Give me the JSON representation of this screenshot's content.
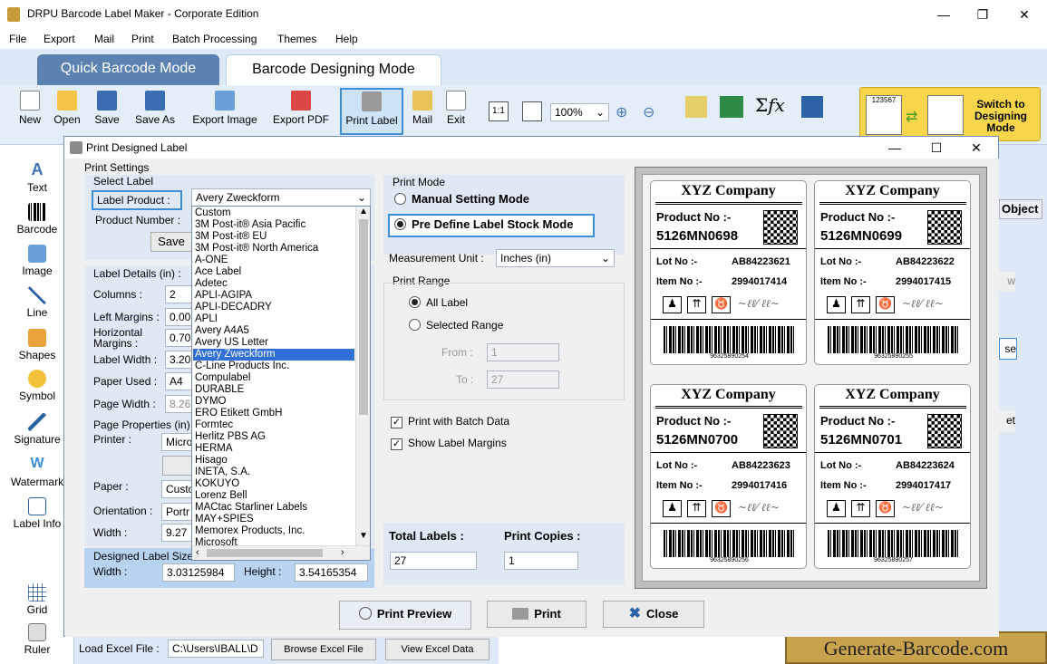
{
  "app": {
    "title": "DRPU Barcode Label Maker - Corporate Edition"
  },
  "menu": [
    "File",
    "Export",
    "Mail",
    "Print",
    "Batch Processing",
    "Themes",
    "Help"
  ],
  "modes": {
    "quick": "Quick Barcode Mode",
    "designing": "Barcode Designing Mode"
  },
  "ribbon": {
    "buttons": [
      "New",
      "Open",
      "Save",
      "Save As",
      "Export Image",
      "Export PDF",
      "Print Label",
      "Mail",
      "Exit"
    ],
    "zoom": "100%",
    "switch_label": "Switch to Designing Mode",
    "thumb_text": "123567"
  },
  "tools": [
    "Text",
    "Barcode",
    "Image",
    "Line",
    "Shapes",
    "Symbol",
    "Signature",
    "Watermark",
    "Label Info",
    "Grid",
    "Ruler"
  ],
  "background": {
    "object_tab": "Object",
    "btn_w": "w",
    "btn_se": "se",
    "btn_et": "et"
  },
  "dialog": {
    "title": "Print Designed Label",
    "print_settings": "Print Settings",
    "select_label": "Select Label",
    "label_product_label": "Label Product :",
    "label_product_value": "Avery Zweckform",
    "product_number_label": "Product Number :",
    "save_btn": "Save",
    "label_details_title": "Label Details (in) :",
    "columns_label": "Columns :",
    "columns_value": "2",
    "left_margins_label": "Left Margins :",
    "left_margins_value": "0.00",
    "horizontal_margins_label": "Horizontal Margins :",
    "horizontal_margins_value": "0.70",
    "label_width_label": "Label Width :",
    "label_width_value": "3.20",
    "paper_used_label": "Paper Used :",
    "paper_used_value": "A4",
    "page_width_label": "Page Width :",
    "page_width_value": "8.26",
    "page_properties_title": "Page Properties (in) :",
    "printer_label": "Printer :",
    "printer_value": "Micro",
    "paper_label": "Paper :",
    "paper_value": "Custo",
    "orientation_label": "Orientation :",
    "orientation_value": "Portr",
    "width_label": "Width :",
    "width_value": "9.27",
    "designed_size_title": "Designed Label Size",
    "designed_width_label": "Width :",
    "designed_width_value": "3.03125984",
    "designed_height_label": "Height :",
    "designed_height_value": "3.54165354",
    "dropdown_items": [
      "Custom",
      "3M  Post-it®  Asia Pacific",
      "3M  Post-it®  EU",
      "3M  Post-it®  North America",
      "A-ONE",
      "Ace Label",
      "Adetec",
      "APLI-AGIPA",
      "APLI-DECADRY",
      "APLI",
      "Avery A4A5",
      "Avery US Letter",
      "Avery Zweckform",
      "C-Line Products Inc.",
      "Compulabel",
      "DURABLE",
      "DYMO",
      "ERO Etikett GmbH",
      "Formtec",
      "Herlitz PBS AG",
      "HERMA",
      "Hisago",
      "INETA, S.A.",
      "KOKUYO",
      "Lorenz Bell",
      "MACtac Starliner Labels",
      "MAY+SPIES",
      "Memorex Products, Inc.",
      "Microsoft"
    ],
    "dropdown_selected": "Avery Zweckform",
    "print_mode_title": "Print Mode",
    "manual_mode": "Manual Setting Mode",
    "predefine_mode": "Pre Define Label Stock Mode",
    "measurement_label": "Measurement Unit :",
    "measurement_value": "Inches (in)",
    "print_range_title": "Print Range",
    "all_label": "All Label",
    "selected_range": "Selected Range",
    "from_label": "From :",
    "from_value": "1",
    "to_label": "To :",
    "to_value": "27",
    "batch_data": "Print with Batch Data",
    "show_margins": "Show Label Margins",
    "total_labels_label": "Total Labels :",
    "total_labels_value": "27",
    "print_copies_label": "Print Copies :",
    "print_copies_value": "1",
    "print_preview_btn": "Print Preview",
    "print_btn": "Print",
    "close_btn": "Close"
  },
  "labels": [
    {
      "company": "XYZ Company",
      "product_label": "Product No :-",
      "product_no": "5126MN0698",
      "lot_label": "Lot No :-",
      "lot_no": "AB84223621",
      "item_label": "Item No :-",
      "item_no": "2994017414",
      "barcode_text": "96325890254"
    },
    {
      "company": "XYZ Company",
      "product_label": "Product No :-",
      "product_no": "5126MN0699",
      "lot_label": "Lot No :-",
      "lot_no": "AB84223622",
      "item_label": "Item No :-",
      "item_no": "2994017415",
      "barcode_text": "96325890255"
    },
    {
      "company": "XYZ Company",
      "product_label": "Product No :-",
      "product_no": "5126MN0700",
      "lot_label": "Lot No :-",
      "lot_no": "AB84223623",
      "item_label": "Item No :-",
      "item_no": "2994017416",
      "barcode_text": "96325890256"
    },
    {
      "company": "XYZ Company",
      "product_label": "Product No :-",
      "product_no": "5126MN0701",
      "lot_label": "Lot No :-",
      "lot_no": "AB84223624",
      "item_label": "Item No :-",
      "item_no": "2994017417",
      "barcode_text": "96325890257"
    }
  ],
  "bottom": {
    "load_excel_label": "Load Excel File :",
    "excel_path": "C:\\Users\\IBALL\\D",
    "browse_btn": "Browse Excel File",
    "view_btn": "View Excel Data"
  },
  "watermark": "Generate-Barcode.com"
}
